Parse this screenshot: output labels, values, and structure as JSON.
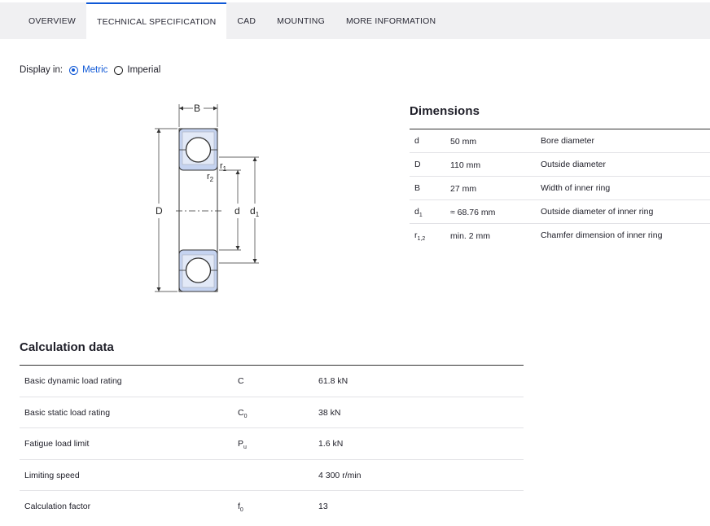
{
  "tabs": [
    {
      "label": "OVERVIEW",
      "active": false
    },
    {
      "label": "TECHNICAL SPECIFICATION",
      "active": true
    },
    {
      "label": "CAD",
      "active": false
    },
    {
      "label": "MOUNTING",
      "active": false
    },
    {
      "label": "MORE INFORMATION",
      "active": false
    }
  ],
  "display": {
    "label": "Display in:",
    "metric": "Metric",
    "imperial": "Imperial",
    "selected": "Metric"
  },
  "drawing": {
    "label_B": "B",
    "label_D": "D",
    "label_d": "d",
    "label_d1": "d",
    "label_d1_sub": "1",
    "label_r1": "r",
    "label_r1_sub": "1",
    "label_r2": "r",
    "label_r2_sub": "2"
  },
  "dimensions": {
    "title": "Dimensions",
    "rows": [
      {
        "sym": "d",
        "sub": "",
        "value": "50 mm",
        "desc": "Bore diameter"
      },
      {
        "sym": "D",
        "sub": "",
        "value": "110 mm",
        "desc": "Outside diameter"
      },
      {
        "sym": "B",
        "sub": "",
        "value": "27 mm",
        "desc": "Width of inner ring"
      },
      {
        "sym": "d",
        "sub": "1",
        "value": "≈ 68.76 mm",
        "desc": "Outside diameter of inner ring"
      },
      {
        "sym": "r",
        "sub": "1,2",
        "value": "min. 2 mm",
        "desc": "Chamfer dimension of inner ring"
      }
    ]
  },
  "calculation": {
    "title": "Calculation data",
    "rows": [
      {
        "label": "Basic dynamic load rating",
        "sym": "C",
        "sub": "",
        "value": "61.8 kN"
      },
      {
        "label": "Basic static load rating",
        "sym": "C",
        "sub": "0",
        "value": "38 kN"
      },
      {
        "label": "Fatigue load limit",
        "sym": "P",
        "sub": "u",
        "value": "1.6 kN"
      },
      {
        "label": "Limiting speed",
        "sym": "",
        "sub": "",
        "value": "4 300 r/min"
      },
      {
        "label": "Calculation factor",
        "sym": "f",
        "sub": "0",
        "value": "13"
      }
    ]
  },
  "colors": {
    "accent": "#0f58d6",
    "ring_fill": "#c5d3f0",
    "tab_bg": "#f0f0f2"
  }
}
